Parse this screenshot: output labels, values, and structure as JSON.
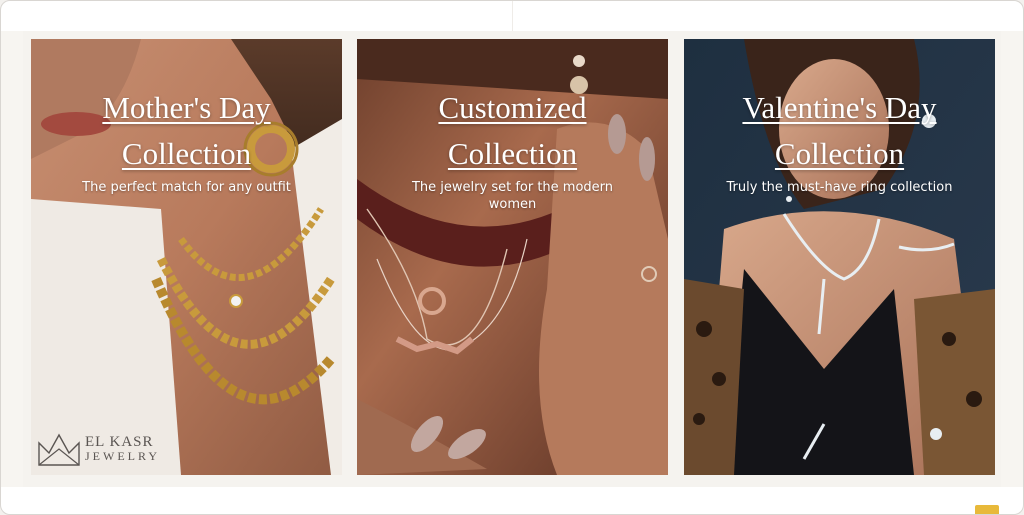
{
  "colors": {
    "page_bg": "#ffffff",
    "band_bg": "#f5f3ef",
    "title_text": "#ffffff",
    "gold": "#c89a3c",
    "badge": "#e8b93a"
  },
  "collections": [
    {
      "title_line1": "Mother's Day",
      "title_line2": "Collection",
      "subtitle": "The perfect match for any outfit"
    },
    {
      "title_line1": "Customized",
      "title_line2": "Collection",
      "subtitle": "The jewelry set for the modern women"
    },
    {
      "title_line1": "Valentine's Day",
      "title_line2": "Collection",
      "subtitle": "Truly the must-have ring collection"
    }
  ],
  "logo": {
    "line1": "EL KASR",
    "line2": "JEWELRY",
    "icon": "crown-icon"
  }
}
